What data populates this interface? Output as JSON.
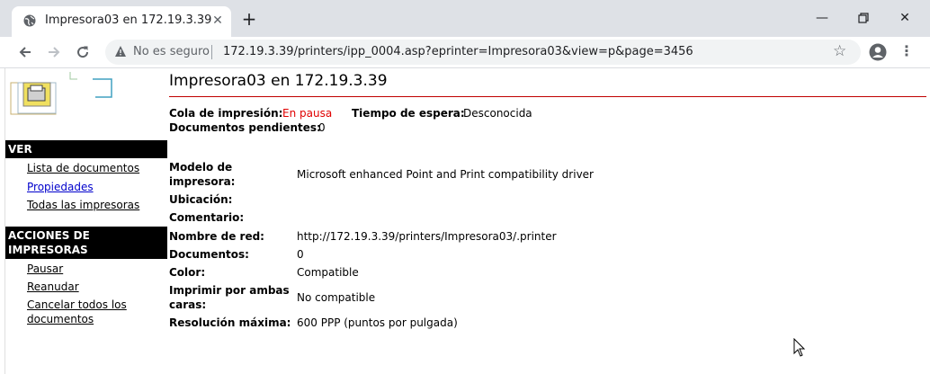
{
  "browser": {
    "tab_title": "Impresora03 en 172.19.3.39",
    "not_secure": "No es seguro",
    "url": "172.19.3.39/printers/ipp_0004.asp?eprinter=Impresora03&view=p&page=3456"
  },
  "sidebar": {
    "ver_header": "VER",
    "ver_items": [
      {
        "label": "Lista de documentos"
      },
      {
        "label": "Propiedades"
      },
      {
        "label": "Todas las impresoras"
      }
    ],
    "acciones_header_1": "ACCIONES DE",
    "acciones_header_2": "IMPRESORAS",
    "acciones_items": [
      {
        "label": "Pausar"
      },
      {
        "label": "Reanudar"
      },
      {
        "label": "Cancelar todos los"
      },
      {
        "label": "documentos"
      }
    ]
  },
  "main": {
    "title": "Impresora03 en 172.19.3.39",
    "queue_label": "Cola de impresión:",
    "queue_value": "En pausa",
    "wait_label": "Tiempo de espera:",
    "wait_value": "Desconocida",
    "pending_label": "Documentos pendientes:",
    "pending_value": "0",
    "props": [
      {
        "label1": "Modelo de",
        "label2": "impresora:",
        "value": "Microsoft enhanced Point and Print compatibility driver"
      },
      {
        "label1": "Ubicación:",
        "value": ""
      },
      {
        "label1": "Comentario:",
        "value": ""
      },
      {
        "label1": "Nombre de red:",
        "value": "http://172.19.3.39/printers/Impresora03/.printer"
      },
      {
        "label1": "Documentos:",
        "value": "0"
      },
      {
        "label1": "Color:",
        "value": "Compatible"
      },
      {
        "label1": "Imprimir por ambas",
        "label2": "caras:",
        "value": "No compatible"
      },
      {
        "label1": "Resolución máxima:",
        "value": "600 PPP (puntos por pulgada)"
      }
    ]
  },
  "colors": {
    "paused": "#e00000",
    "rule": "#c00000",
    "link_active": "#0000cc"
  }
}
